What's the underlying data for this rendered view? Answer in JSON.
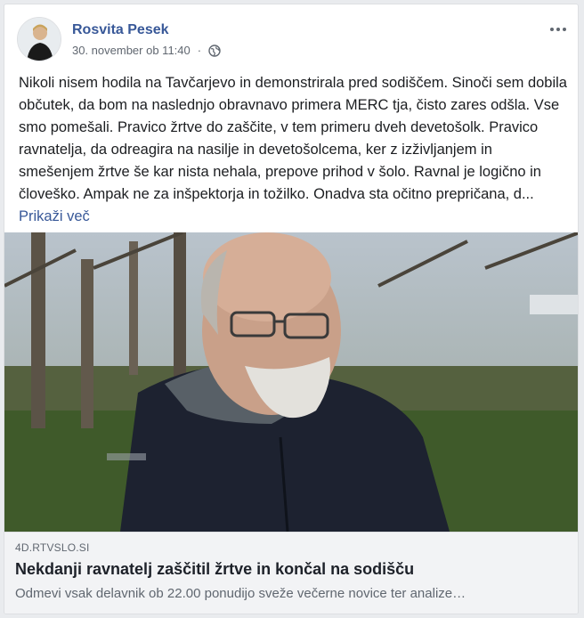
{
  "post": {
    "author": "Rosvita Pesek",
    "timestamp": "30. november ob 11:40",
    "separator": "·",
    "privacy_icon": "globe-icon",
    "more_icon": "more-options-icon",
    "text": "Nikoli nisem hodila na Tavčarjevo in demonstrirala pred sodiščem. Sinoči sem dobila občutek, da bom na naslednjo obravnavo primera MERC tja, čisto zares odšla. Vse smo pomešali. Pravico žrtve do zaščite, v tem primeru dveh devetošolk. Pravico ravnatelja, da odreagira na nasilje in devetošolcema, ker z izživljanjem in smešenjem žrtve še kar nista nehala, prepove prihod v šolo. Ravnal je logično in človeško. Ampak ne za inšpektorja in tožilko. Onadva sta očitno prepričana, d...",
    "see_more": "Prikaži več"
  },
  "link": {
    "domain": "4D.RTVSLO.SI",
    "title": "Nekdanji ravnatelj zaščitil žrtve in končal na sodišču",
    "description": "Odmevi vsak delavnik ob 22.00 ponudijo sveže večerne novice ter analize…"
  },
  "colors": {
    "author_link": "#385898",
    "meta_text": "#606770",
    "footer_bg": "#f2f3f5"
  }
}
